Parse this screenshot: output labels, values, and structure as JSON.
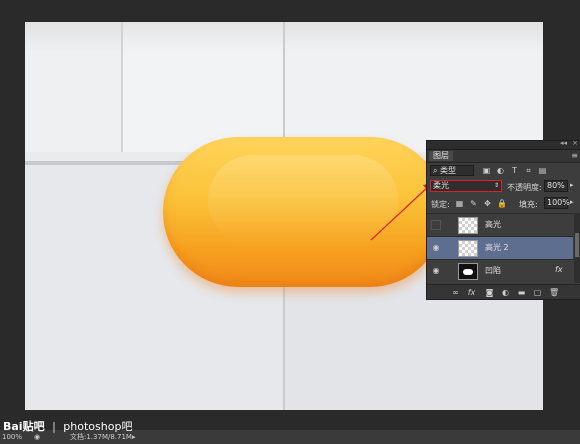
{
  "layers_panel": {
    "title": "图层",
    "filter_kind": "类型",
    "blend_mode": "柔光",
    "opacity_label": "不透明度:",
    "opacity_value": "80%",
    "lock_label": "锁定:",
    "fill_label": "填充:",
    "fill_value": "100%",
    "layers": [
      {
        "name": "高光",
        "visible": false,
        "selected": false
      },
      {
        "name": "高光 2",
        "visible": true,
        "selected": true
      },
      {
        "name": "凹陷",
        "visible": true,
        "selected": false
      }
    ],
    "fx_badge": "fx"
  },
  "status_bar": {
    "zoom": "100%",
    "doc_label": "文档:1.37M/8.71M"
  },
  "watermark": {
    "brand": "Bai贴吧",
    "text": "photoshop吧"
  },
  "colors": {
    "annotation_red": "#e02020",
    "selected_layer": "#5d6e8f"
  }
}
